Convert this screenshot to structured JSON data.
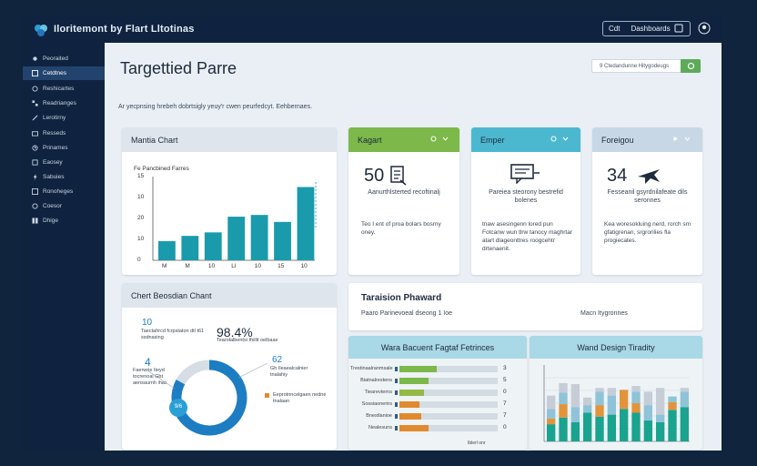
{
  "app": {
    "title": "Iloritemont by Flart Lltotinas",
    "top_buttons": [
      {
        "left": "Cdt",
        "right": "Dashboards"
      }
    ]
  },
  "sidebar": {
    "items": [
      {
        "label": "Peoraited",
        "icon": "pin-icon"
      },
      {
        "label": "Cetdtnes",
        "icon": "grid-icon"
      },
      {
        "label": "Reshicartes",
        "icon": "circle-icon"
      },
      {
        "label": "Readrianges",
        "icon": "grid-icon"
      },
      {
        "label": "Lerotirny",
        "icon": "pencil-icon"
      },
      {
        "label": "Resseds",
        "icon": "folder-icon"
      },
      {
        "label": "Prinames",
        "icon": "clock-icon"
      },
      {
        "label": "Eaosey",
        "icon": "box-icon"
      },
      {
        "label": "Sabuies",
        "icon": "bolt-icon"
      },
      {
        "label": "Ronoheges",
        "icon": "grid-icon"
      },
      {
        "label": "Coesor",
        "icon": "circle-icon"
      },
      {
        "label": "Dhige",
        "icon": "grid-icon"
      }
    ]
  },
  "main": {
    "title": "Targettied Parre",
    "subtitle": "Ar yecpnsing hrebeh dobrtsigly yeuy'r cwen peurfedcyt. Eehbernaes.",
    "search": {
      "placeholder": "9 Ctedandunne Hitygodeugs"
    }
  },
  "cards": {
    "mantia": {
      "title": "Mantia Chart",
      "chart_title": "Fe Pancbined Farres",
      "y_ticks": [
        "15",
        "10",
        "20",
        "10",
        "0"
      ],
      "x_ticks": [
        "M",
        "M",
        "10",
        "Ll",
        "10",
        "15",
        "10"
      ]
    },
    "kagart": {
      "title": "Kagart",
      "value": "50",
      "caption": "Aanurthlsterted recoftinalj",
      "desc": "Teo I ent of proa bolars bosrny oney."
    },
    "emper": {
      "title": "Emper",
      "caption": "Pareiea steorony bestrefid bolenes",
      "desc": "tnaw asesingenn lored pun Fotcanw wun tlrw tanocy maghrtar atart dlageonttres roogcehtr drtenaenit."
    },
    "foreigou": {
      "title": "Foreigou",
      "value": "34",
      "caption": "Fesseanil gsyrdnilafeate dils seronnes",
      "desc": "Kea woresokluing nerd, rorch sm gfatigrenan, srgrorilies fla progiecates."
    },
    "donut": {
      "title": "Chert Beosdian Chant",
      "stat1_value": "10",
      "stat1_caption": "Taectahrcd fcrpstaton dtl t61 ssdnasing",
      "stat2_value": "98.4%",
      "stat2_caption": "Tearolalbentsi Ifsllit oelbaas",
      "stat3_value": "4",
      "stat3_caption": "Faerwrie Iteyd tocrenoal Gbt aensaurnh ihas",
      "stat4_value": "62",
      "stat4_caption": "Gh Ileaealcalnier tnalahiy",
      "legend": "Eeprotnncelgaen nedne tnalaan",
      "center_label": "9/6"
    },
    "taraision": {
      "title": "Taraision Phaward",
      "left": "Paaro Parinevoeal dseong 1 Ioe",
      "right": "Macn Itygronnes"
    },
    "hbar": {
      "title": "Wara Bacuent Fagtaf Fetrinces",
      "rows": [
        {
          "label": "Trestinaalranmsale",
          "value": "3"
        },
        {
          "label": "Biatnalrestens",
          "value": "5"
        },
        {
          "label": "Tiearevterns",
          "value": "0"
        },
        {
          "label": "Sossiaonerirs",
          "value": "7"
        },
        {
          "label": "Bnestlanioe",
          "value": "7"
        },
        {
          "label": "Nealesuns",
          "value": "0"
        }
      ],
      "x_label": "Iblerl onr"
    },
    "stacked": {
      "title": "Wand Design Tiradity"
    }
  },
  "chart_data": [
    {
      "type": "bar",
      "title": "Fe Pancbined Farres",
      "categories": [
        "M",
        "M",
        "10",
        "Ll",
        "10",
        "15",
        "10"
      ],
      "values": [
        5.5,
        7,
        8,
        12.5,
        13,
        11,
        21
      ],
      "ylim": [
        0,
        24
      ],
      "color": "#1a9bac"
    },
    {
      "type": "pie",
      "title": "Chert Beosdian Chant",
      "values": [
        83,
        17
      ],
      "colors": [
        "#1d7dc2",
        "#d6dde5"
      ]
    },
    {
      "type": "bar",
      "orientation": "horizontal",
      "title": "Wara Bacuent Fagtaf Fetrinces",
      "categories": [
        "Trestinaalranmsale",
        "Biatnalrestens",
        "Tiearevterns",
        "Sossiaonerirs",
        "Bnestlanioe",
        "Nealesuns"
      ],
      "series": [
        {
          "values": [
            0.38,
            0.3,
            0.25,
            0.2,
            0.22,
            0.3
          ],
          "color_by_row": [
            "#7cb84a",
            "#7cb84a",
            "#95b947",
            "#e08a30",
            "#e08a30",
            "#e08a30"
          ]
        }
      ],
      "xlim": [
        0,
        1
      ]
    },
    {
      "type": "bar",
      "stacked": true,
      "title": "Wand Design Tiradity",
      "categories": [
        "1",
        "2",
        "3",
        "4",
        "5",
        "6",
        "7",
        "8",
        "9",
        "10",
        "11",
        "12"
      ],
      "series": [
        {
          "values": [
            18,
            25,
            20,
            30,
            26,
            28,
            34,
            30,
            22,
            20,
            33,
            36
          ],
          "color": "#1aa38e"
        },
        {
          "values": [
            6,
            14,
            0,
            0,
            12,
            0,
            20,
            10,
            0,
            0,
            8,
            0
          ],
          "color": "#e2943a"
        },
        {
          "values": [
            10,
            12,
            16,
            8,
            14,
            20,
            0,
            12,
            16,
            8,
            6,
            16
          ],
          "color": "#8fc3d8"
        },
        {
          "values": [
            14,
            10,
            24,
            8,
            4,
            8,
            0,
            6,
            14,
            28,
            0,
            4
          ],
          "color": "#c6cdd6"
        }
      ],
      "ylim": [
        0,
        80
      ]
    }
  ]
}
